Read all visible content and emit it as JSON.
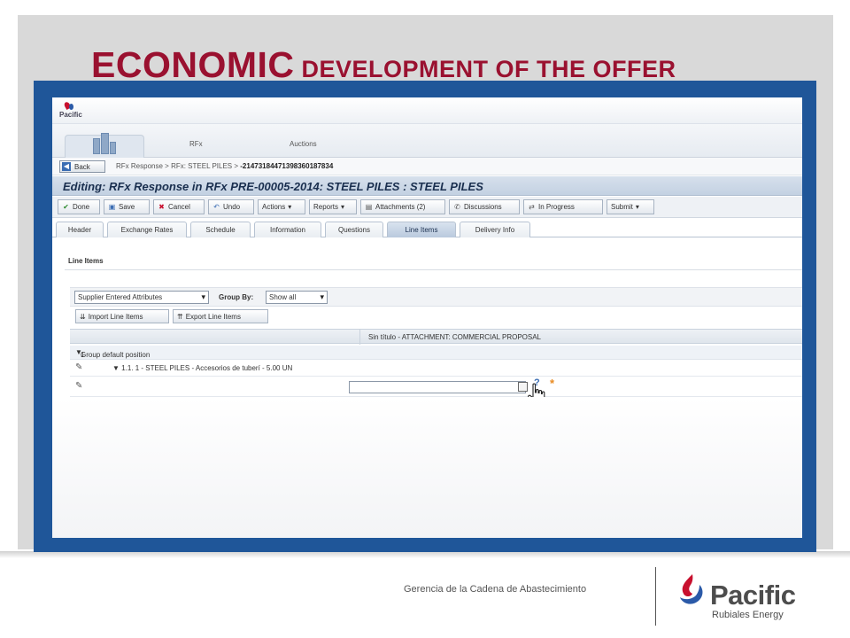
{
  "slide": {
    "title_big": "ECONOMIC",
    "title_small": " DEVELOPMENT OF THE OFFER",
    "footer_text": "Gerencia de la Cadena de Abastecimiento",
    "logo_word": "Pacific",
    "logo_sub": "Rubiales Energy"
  },
  "app": {
    "mini_logo_text": "Pacific",
    "nav": [
      "RFx",
      "Auctions"
    ],
    "back_label": "Back",
    "breadcrumb_a": "RFx Response",
    "breadcrumb_b": "RFx: STEEL PILES",
    "breadcrumb_c": "-21473184471398360187834",
    "breadcrumb_sep": ">",
    "editing_title": "Editing: RFx Response in RFx PRE-00005-2014: STEEL PILES : STEEL PILES",
    "toolbar": [
      {
        "label": "Done",
        "icon": "check-icon"
      },
      {
        "label": "Save",
        "icon": "save-icon"
      },
      {
        "label": "Cancel",
        "icon": "cancel-icon"
      },
      {
        "label": "Undo",
        "icon": "undo-icon"
      },
      {
        "label": "Actions",
        "icon": "dropdown-icon"
      },
      {
        "label": "Reports",
        "icon": "dropdown-icon"
      },
      {
        "label": "Attachments (2)",
        "icon": "attachment-icon"
      },
      {
        "label": "Discussions",
        "icon": "discussion-icon"
      },
      {
        "label": "In Progress",
        "icon": "status-icon"
      },
      {
        "label": "Submit",
        "icon": "dropdown-icon"
      }
    ],
    "tabs": [
      "Header",
      "Exchange Rates",
      "Schedule",
      "Information",
      "Questions",
      "Line Items",
      "Delivery Info"
    ],
    "active_tab": "Line Items",
    "section_title": "Line Items",
    "filter_select": "Supplier Entered Attributes",
    "group_by_label": "Group By:",
    "group_by_value": "Show all",
    "import_label": "Import Line Items",
    "export_label": "Export Line Items",
    "column_header": "Sin título - ATTACHMENT: COMMERCIAL PROPOSAL",
    "group_row_prefix": "1",
    "group_row": "Group default position",
    "item_row": "1.1. 1 - STEEL PILES - Accesorios de tuberí - 5.00 UN",
    "help_mark": "?",
    "required_mark": "*"
  },
  "colors": {
    "title": "#9a1130",
    "frame_blue": "#1f5699",
    "upper_gray": "#d9d9d9",
    "logo_red": "#c8102e",
    "logo_blue": "#2b5aa8",
    "logo_text": "#4d4d4d"
  }
}
